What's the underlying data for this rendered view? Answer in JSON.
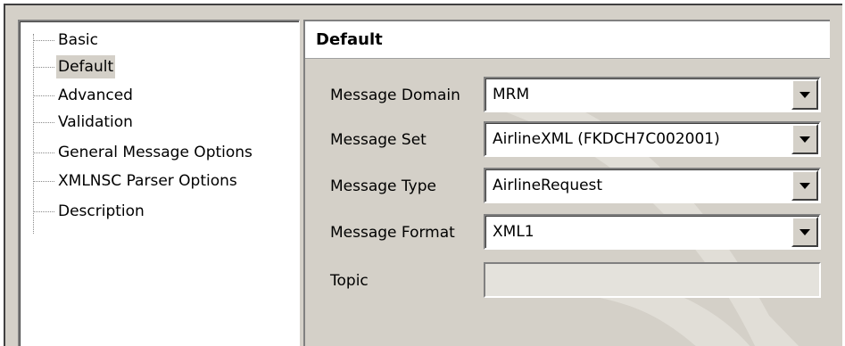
{
  "tree": {
    "items": [
      {
        "label": "Basic",
        "selected": false
      },
      {
        "label": "Default",
        "selected": true
      },
      {
        "label": "Advanced",
        "selected": false
      },
      {
        "label": "Validation",
        "selected": false
      },
      {
        "label": "General Message Options",
        "selected": false
      },
      {
        "label": "XMLNSC Parser Options",
        "selected": false
      },
      {
        "label": "Description",
        "selected": false
      }
    ]
  },
  "page": {
    "title": "Default"
  },
  "form": {
    "message_domain": {
      "label": "Message Domain",
      "value": "MRM"
    },
    "message_set": {
      "label": "Message Set",
      "value": "AirlineXML (FKDCH7C002001)"
    },
    "message_type": {
      "label": "Message Type",
      "value": "AirlineRequest"
    },
    "message_format": {
      "label": "Message Format",
      "value": "XML1"
    },
    "topic": {
      "label": "Topic",
      "value": ""
    }
  },
  "icons": {
    "dropdown": "chevron-down-icon"
  },
  "colors": {
    "panel": "#d4d0c8",
    "field": "#ffffff",
    "disabled_field": "#e4e2dc"
  }
}
